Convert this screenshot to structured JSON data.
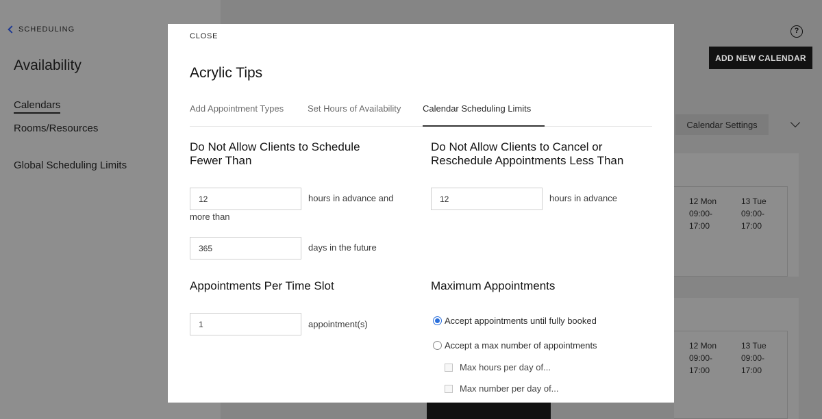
{
  "sidebar": {
    "back_label": "SCHEDULING",
    "title": "Availability",
    "items": [
      "Calendars",
      "Rooms/Resources",
      "Global Scheduling Limits"
    ]
  },
  "header": {
    "add_calendar_label": "ADD NEW CALENDAR",
    "help_glyph": "?"
  },
  "calendar_panel": {
    "settings_label": "Calendar Settings",
    "days": [
      {
        "name": "12 Mon",
        "hours": "09:00-\n17:00"
      },
      {
        "name": "13 Tue",
        "hours": "09:00-\n17:00"
      }
    ]
  },
  "modal": {
    "close_label": "CLOSE",
    "title": "Acrylic Tips",
    "tabs": [
      "Add Appointment Types",
      "Set Hours of Availability",
      "Calendar Scheduling Limits"
    ],
    "active_tab": 2,
    "schedule_limit": {
      "title": "Do Not Allow Clients to Schedule Fewer Than",
      "min_hours_value": "12",
      "min_hours_suffix": "hours in advance and",
      "more_than_label": "more than",
      "max_days_value": "365",
      "max_days_suffix": "days in the future"
    },
    "cancel_limit": {
      "title": "Do Not Allow Clients to Cancel or Reschedule Appointments Less Than",
      "hours_value": "12",
      "hours_suffix": "hours in advance"
    },
    "per_slot": {
      "title": "Appointments Per Time Slot",
      "value": "1",
      "suffix": "appointment(s)"
    },
    "maximum": {
      "title": "Maximum Appointments",
      "options": [
        "Accept appointments until fully booked",
        "Accept a max number of appointments"
      ],
      "selected": 0,
      "checkboxes": [
        "Max hours per day of...",
        "Max number per day of..."
      ]
    }
  },
  "colors": {
    "accent": "#2a6fdb",
    "overlay": "#8c8c8c",
    "primary_button": "#121212"
  }
}
